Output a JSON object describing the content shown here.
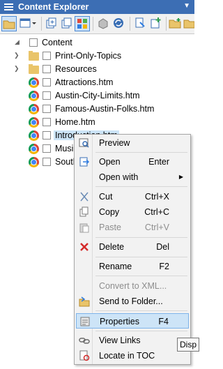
{
  "window": {
    "title": "Content Explorer",
    "menu_arrow": "▼"
  },
  "toolbar": {
    "buttons": [
      "open-folder-icon",
      "view-layout-icon",
      "view-dropdown-icon",
      "new-topic-icon",
      "copy-icon",
      "color-grid-icon",
      "box-icon",
      "refresh-icon",
      "find-icon",
      "add-icon",
      "folder-icon",
      "folder-add-icon"
    ]
  },
  "tree": {
    "root": "Content",
    "items": [
      {
        "label": "Print-Only-Topics",
        "type": "folder"
      },
      {
        "label": "Resources",
        "type": "folder"
      },
      {
        "label": "Attractions.htm",
        "type": "file"
      },
      {
        "label": "Austin-City-Limits.htm",
        "type": "file"
      },
      {
        "label": "Famous-Austin-Folks.htm",
        "type": "file"
      },
      {
        "label": "Home.htm",
        "type": "file"
      },
      {
        "label": "Introduction.htm",
        "type": "file"
      },
      {
        "label": "Musi",
        "type": "file"
      },
      {
        "label": "South",
        "type": "file"
      }
    ]
  },
  "context_menu": {
    "items": [
      {
        "label": "Preview",
        "shortcut": ""
      },
      {
        "label": "Open",
        "shortcut": "Enter"
      },
      {
        "label": "Open with",
        "shortcut": "",
        "submenu": "▶"
      },
      {
        "label": "Cut",
        "shortcut": "Ctrl+X"
      },
      {
        "label": "Copy",
        "shortcut": "Ctrl+C"
      },
      {
        "label": "Paste",
        "shortcut": "Ctrl+V"
      },
      {
        "label": "Delete",
        "shortcut": "Del"
      },
      {
        "label": "Rename",
        "shortcut": "F2"
      },
      {
        "label": "Convert to XML...",
        "shortcut": ""
      },
      {
        "label": "Send to Folder...",
        "shortcut": ""
      },
      {
        "label": "Properties",
        "shortcut": "F4"
      },
      {
        "label": "View Links",
        "shortcut": ""
      },
      {
        "label": "Locate in TOC",
        "shortcut": ""
      }
    ]
  },
  "tooltip": "Disp",
  "colors": {
    "title_bg": "#3c6eb4",
    "highlight": "#cde4f7",
    "selection": "#cce4f7"
  }
}
